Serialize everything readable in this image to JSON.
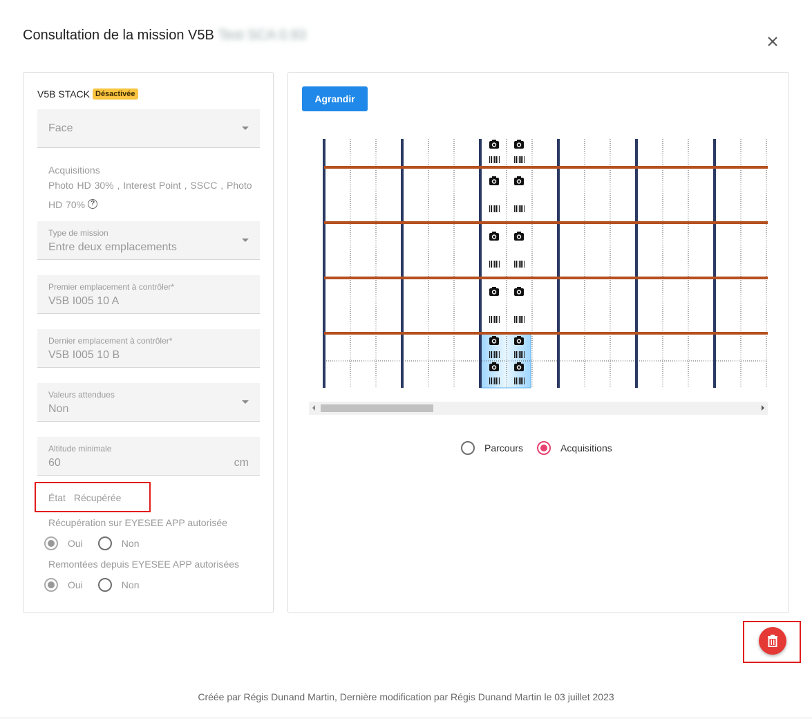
{
  "dialog": {
    "title": "Consultation de la mission V5B",
    "title_blurred": "Test SCA 0.93"
  },
  "left": {
    "stack_label": "V5B STACK",
    "stack_badge": "Désactivée",
    "face": {
      "value": "Face"
    },
    "acquisitions": {
      "label": "Acquisitions",
      "value": "Photo HD 30% , Interest Point , SSCC , Photo HD 70%",
      "help_icon": "help-circle-icon"
    },
    "mission_type": {
      "label": "Type de mission",
      "value": "Entre deux emplacements"
    },
    "first_location": {
      "label": "Premier emplacement à contrôler*",
      "value": "V5B I005 10 A"
    },
    "last_location": {
      "label": "Dernier emplacement à contrôler*",
      "value": "V5B I005 10 B"
    },
    "expected_values": {
      "label": "Valeurs attendues",
      "value": "Non"
    },
    "min_altitude": {
      "label": "Altitude minimale",
      "value": "60",
      "unit": "cm"
    },
    "state": {
      "label": "État",
      "value": "Récupérée"
    },
    "recovery": {
      "label": "Récupération sur EYESEE APP autorisée",
      "options": [
        "Oui",
        "Non"
      ],
      "selected": "Oui"
    },
    "uploads": {
      "label": "Remontées depuis EYESEE APP autorisées",
      "options": [
        "Oui",
        "Non"
      ],
      "selected": "Oui"
    }
  },
  "right": {
    "enlarge_button": "Agrandir",
    "view_options": [
      "Parcours",
      "Acquisitions"
    ],
    "view_selected": "Acquisitions",
    "rack_levels": 5,
    "scroll_position": 0.0
  },
  "colors": {
    "primary": "#1f88e8",
    "badge": "#f9c440",
    "beam": "#b5501f",
    "upright": "#2b3a63",
    "delete": "#e53935",
    "radio_accent": "#e8406f",
    "highlight": "#e21b1b"
  },
  "footer": {
    "text": "Créée par Régis Dunand Martin, Dernière modification par Régis Dunand Martin le 03 juillet 2023"
  },
  "icons": {
    "close": "close-icon",
    "delete": "trash-icon",
    "camera": "camera-icon",
    "barcode": "barcode-icon"
  }
}
